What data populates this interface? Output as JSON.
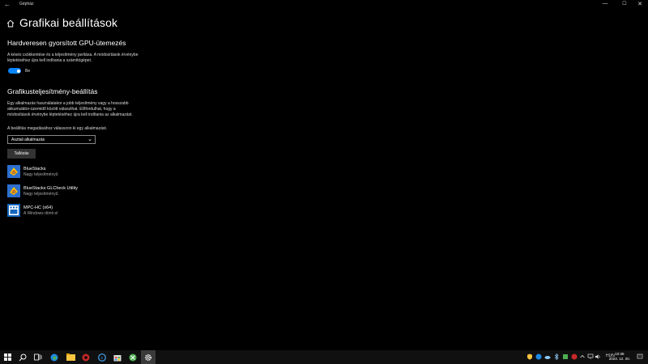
{
  "window": {
    "title": "Gépház",
    "back_glyph": "←",
    "minimize_glyph": "—",
    "maximize_glyph": "☐",
    "close_glyph": "✕"
  },
  "page": {
    "title": "Grafikai beállítások"
  },
  "gpu_section": {
    "heading": "Hardveresen gyorsított GPU-ütemezés",
    "desc_line1": "A késés csökkentése és a teljesítmény javítása. A módosítások érvénybe",
    "desc_line2": "léptetéséhez újra kell indítania a számítógépet.",
    "toggle_state": "on",
    "toggle_label": "Be"
  },
  "perf_section": {
    "heading": "Grafikusteljesítmény-beállítás",
    "desc_line1": "Egy alkalmazás használatakor a jobb teljesítmény vagy a hosszabb",
    "desc_line2": "akkumulátor-üzemidő között választhat. Előfordulhat, hogy a",
    "desc_line3": "módosítások érvénybe léptetéséhez újra kell indítania az alkalmazást.",
    "choose_label": "A beállítás megadásához válasszon ki egy alkalmazást.",
    "dropdown_value": "Asztali alkalmazás",
    "browse_button": "Tallózás"
  },
  "apps": [
    {
      "name": "BlueStacks",
      "preference": "Nagy teljesítményű",
      "icon": "bluestacks-icon"
    },
    {
      "name": "BlueStacks GLCheck Utility",
      "preference": "Nagy teljesítményű",
      "icon": "bluestacks-icon"
    },
    {
      "name": "MPC-HC (x64)",
      "preference": "A Windows dönti el",
      "icon": "mpc-hc-icon"
    }
  ],
  "taskbar": {
    "language": "HUN",
    "time": "10:38",
    "date": "2023. 12. 20."
  },
  "colors": {
    "accent": "#0a84ff",
    "background": "#000000",
    "taskbar": "#101010"
  }
}
